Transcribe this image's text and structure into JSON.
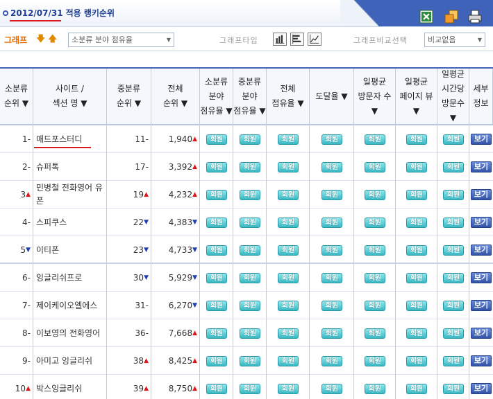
{
  "header": {
    "date": "2012/07/31",
    "title": "적용 랭키순위",
    "icons": [
      "excel-icon",
      "copy-icon",
      "print-icon"
    ]
  },
  "controls": {
    "graph_label": "그래프",
    "category_select": "소분류 분야 점유율",
    "graph_type_label": "그래프타입",
    "compare_label": "그래프비교선택",
    "compare_select": "비교없음"
  },
  "table": {
    "headers": [
      [
        "소분류",
        "순위 ▼"
      ],
      [
        "사이트 /",
        "섹션 명 ▼"
      ],
      [
        "중분류",
        "순위 ▼"
      ],
      [
        "전체",
        "순위 ▼"
      ],
      [
        "소분류",
        "분야",
        "점유율 ▼"
      ],
      [
        "중분류",
        "분야",
        "점유율 ▼"
      ],
      [
        "전체",
        "점유율 ▼"
      ],
      [
        "도달율 ▼"
      ],
      [
        "일평균",
        "방문자 수",
        "▼"
      ],
      [
        "일평균",
        "페이지 뷰",
        "▼"
      ],
      [
        "일평균",
        "시간당",
        "방문수 ▼"
      ],
      [
        "세부",
        "정보"
      ]
    ],
    "member_label": "회원",
    "view_label": "보기",
    "rows": [
      {
        "rank": "1",
        "rank_change": "-",
        "name": "매드포스터디",
        "mid": "11",
        "mid_change": "-",
        "total": "1,940",
        "total_change": "up"
      },
      {
        "rank": "2",
        "rank_change": "-",
        "name": "슈퍼톡",
        "mid": "17",
        "mid_change": "-",
        "total": "3,392",
        "total_change": "up"
      },
      {
        "rank": "3",
        "rank_change": "up",
        "name": "민병철 전화영어 유폰",
        "mid": "19",
        "mid_change": "up",
        "total": "4,232",
        "total_change": "up"
      },
      {
        "rank": "4",
        "rank_change": "-",
        "name": "스피쿠스",
        "mid": "22",
        "mid_change": "down",
        "total": "4,383",
        "total_change": "down"
      },
      {
        "rank": "5",
        "rank_change": "down",
        "name": "이티폰",
        "mid": "23",
        "mid_change": "down",
        "total": "4,733",
        "total_change": "down"
      },
      {
        "rank": "6",
        "rank_change": "-",
        "name": "잉글리쉬프로",
        "mid": "30",
        "mid_change": "down",
        "total": "5,929",
        "total_change": "down"
      },
      {
        "rank": "7",
        "rank_change": "-",
        "name": "제이케이오엘에스",
        "mid": "31",
        "mid_change": "-",
        "total": "6,270",
        "total_change": "down"
      },
      {
        "rank": "8",
        "rank_change": "-",
        "name": "이보영의 전화영어",
        "mid": "36",
        "mid_change": "-",
        "total": "7,668",
        "total_change": "up"
      },
      {
        "rank": "9",
        "rank_change": "-",
        "name": "아미고 잉글리쉬",
        "mid": "38",
        "mid_change": "up",
        "total": "8,425",
        "total_change": "up"
      },
      {
        "rank": "10",
        "rank_change": "up",
        "name": "박스잉글리쉬",
        "mid": "39",
        "mid_change": "up",
        "total": "8,750",
        "total_change": "up"
      }
    ]
  }
}
